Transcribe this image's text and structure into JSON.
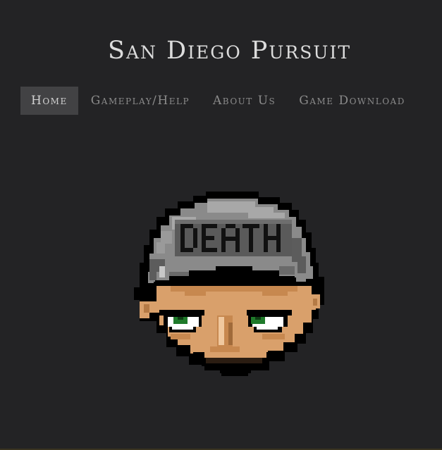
{
  "site": {
    "title": "San Diego Pursuit"
  },
  "nav": {
    "items": [
      {
        "label": "Home",
        "active": true
      },
      {
        "label": "Gameplay/Help",
        "active": false
      },
      {
        "label": "About Us",
        "active": false
      },
      {
        "label": "Game Download",
        "active": false
      }
    ]
  },
  "mascot": {
    "beanie_text": "DEATH",
    "icon": "pixel-art-head-with-beanie"
  },
  "colors": {
    "background": "#232325",
    "active_nav_bg": "#424244",
    "title_text": "#dcdcdc",
    "nav_text": "#8b8b8b",
    "beanie": "#8a8a8a",
    "skin": "#d9a06b",
    "eye_iris": "#1f7a2a",
    "outline": "#000000"
  }
}
